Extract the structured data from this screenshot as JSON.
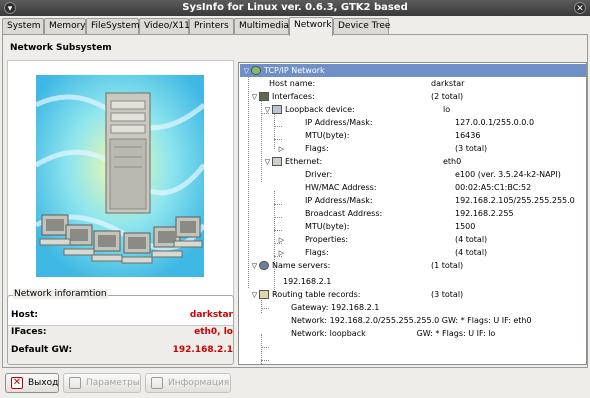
{
  "window": {
    "title": "SysInfo for Linux ver. 0.6.3, GTK2 based"
  },
  "tabs": [
    "System",
    "Memory",
    "FileSystem",
    "Video/X11",
    "Printers",
    "Multimedia",
    "Network",
    "Device Tree"
  ],
  "subsystem_title": "Network Subsystem",
  "info": {
    "legend": "Network inforamtion",
    "rows": [
      {
        "label": "Host:",
        "value": "darkstar"
      },
      {
        "label": "IFaces:",
        "value": "eth0, lo"
      },
      {
        "label": "Default GW:",
        "value": "192.168.2.1"
      }
    ]
  },
  "tree": {
    "root": "TCP/IP Network",
    "host_name": {
      "label": "Host name:",
      "value": "darkstar"
    },
    "interfaces": {
      "label": "Interfaces:",
      "value": "(2 total)"
    },
    "loopback": {
      "label": "Loopback device:",
      "value": "lo"
    },
    "lo_ip": {
      "label": "IP Address/Mask:",
      "value": "127.0.0.1/255.0.0.0"
    },
    "lo_mtu": {
      "label": "MTU(byte):",
      "value": "16436"
    },
    "lo_flags": {
      "label": "Flags:",
      "value": "(3 total)"
    },
    "ethernet": {
      "label": "Ethernet:",
      "value": "eth0"
    },
    "eth_driver": {
      "label": "Driver:",
      "value": "e100 (ver. 3.5.24-k2-NAPI)"
    },
    "eth_mac": {
      "label": "HW/MAC Address:",
      "value": "00:02:A5:C1:BC:52"
    },
    "eth_ip": {
      "label": "IP Address/Mask:",
      "value": "192.168.2.105/255.255.255.0"
    },
    "eth_bcast": {
      "label": "Broadcast Address:",
      "value": "192.168.2.255"
    },
    "eth_mtu": {
      "label": "MTU(byte):",
      "value": "1500"
    },
    "eth_props": {
      "label": "Properties:",
      "value": "(4 total)"
    },
    "eth_flags": {
      "label": "Flags:",
      "value": "(4 total)"
    },
    "ns": {
      "label": "Name servers:",
      "value": "(1 total)"
    },
    "ns_item": "192.168.2.1",
    "routing": {
      "label": "Routing table records:",
      "value": "(3 total)"
    },
    "route1": "Gateway: 192.168.2.1",
    "route2": "Network: 192.168.2.0/255.255.255.0 GW: * Flags: U IF: eth0",
    "route3": "Network: loopback                    GW: * Flags: U IF: lo"
  },
  "buttons": {
    "exit": "Выход",
    "params": "Параметры",
    "info": "Информация"
  }
}
